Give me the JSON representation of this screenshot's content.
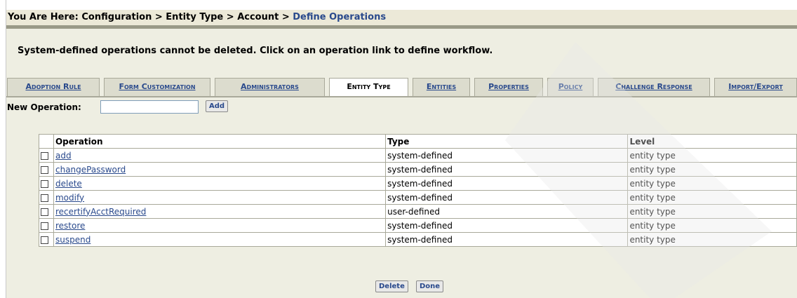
{
  "breadcrumb": {
    "prefix": "You Are Here: Configuration > Entity Type > Account > ",
    "current": "Define Operations"
  },
  "notice": "System-defined operations cannot be deleted. Click on an operation link to define workflow.",
  "tabs": [
    {
      "label": "Adoption Rule",
      "active": false
    },
    {
      "label": "Form Customization",
      "active": false
    },
    {
      "label": "Administrators",
      "active": false
    },
    {
      "label": "Entity Type",
      "active": true
    },
    {
      "label": "Entities",
      "active": false
    },
    {
      "label": "Properties",
      "active": false
    },
    {
      "label": "Policy",
      "active": false
    },
    {
      "label": "Challenge Response",
      "active": false
    },
    {
      "label": "Import/Export",
      "active": false
    }
  ],
  "new_operation": {
    "label": "New Operation:",
    "value": "",
    "add_label": "Add"
  },
  "table": {
    "headers": {
      "operation": "Operation",
      "type": "Type",
      "level": "Level"
    },
    "rows": [
      {
        "operation": "add",
        "type": "system-defined",
        "level": "entity type",
        "checked": false
      },
      {
        "operation": "changePassword",
        "type": "system-defined",
        "level": "entity type",
        "checked": false
      },
      {
        "operation": "delete",
        "type": "system-defined",
        "level": "entity type",
        "checked": false
      },
      {
        "operation": "modify",
        "type": "system-defined",
        "level": "entity type",
        "checked": false
      },
      {
        "operation": "recertifyAcctRequired",
        "type": "user-defined",
        "level": "entity type",
        "checked": false
      },
      {
        "operation": "restore",
        "type": "system-defined",
        "level": "entity type",
        "checked": false
      },
      {
        "operation": "suspend",
        "type": "system-defined",
        "level": "entity type",
        "checked": false
      }
    ]
  },
  "buttons": {
    "delete_label": "Delete",
    "done_label": "Done"
  },
  "colors": {
    "link": "#29498c",
    "panel": "#eeeee2",
    "tab": "#dcdcce",
    "breadcrumb_bg": "#ece9d8"
  }
}
